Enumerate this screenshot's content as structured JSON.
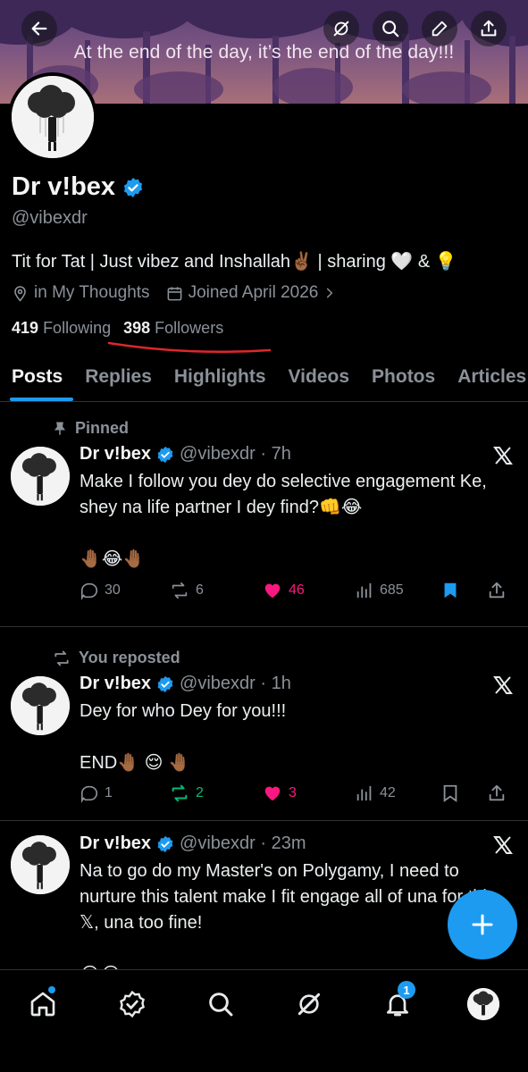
{
  "banner": {
    "text": "At the end of the day, it’s the end of the day!!!"
  },
  "profile": {
    "name": "Dr v!bex",
    "handle": "@vibexdr",
    "bio": "Tit for Tat | Just vibez and Inshallah✌🏾 | sharing 🤍  &  💡",
    "location": "in My Thoughts",
    "joined": "Joined April 2026",
    "following_count": "419",
    "following_label": "Following",
    "followers_count": "398",
    "followers_label": "Followers"
  },
  "tabs": [
    {
      "label": "Posts"
    },
    {
      "label": "Replies"
    },
    {
      "label": "Highlights"
    },
    {
      "label": "Videos"
    },
    {
      "label": "Photos"
    },
    {
      "label": "Articles"
    }
  ],
  "posts": [
    {
      "context": "Pinned",
      "name": "Dr v!bex",
      "meta": "@vibexdr · 7h",
      "text": "Make I follow you dey do selective engagement Ke, shey na life partner I dey find?👊😂\n\n🤚🏾😂🤚🏾",
      "replies": "30",
      "reposts": "6",
      "likes": "46",
      "views": "685"
    },
    {
      "context": "You reposted",
      "name": "Dr v!bex",
      "meta": "@vibexdr · 1h",
      "text": "Dey for who Dey for you!!!\n\nEND🤚🏾 😌 🤚🏾",
      "replies": "1",
      "reposts": "2",
      "likes": "3",
      "views": "42"
    },
    {
      "name": "Dr v!bex",
      "meta": "@vibexdr · 23m",
      "text": "Na to go do my Master's on Polygamy, I need to nurture this talent make I fit engage all of una for this 𝕏, una too fine!\n\n😂😂"
    }
  ],
  "nav": {
    "notifications_badge": "1"
  },
  "colors": {
    "accent": "#1d9bf0",
    "like": "#f91880",
    "repost": "#00ba7c",
    "underline": "#e0262b"
  }
}
